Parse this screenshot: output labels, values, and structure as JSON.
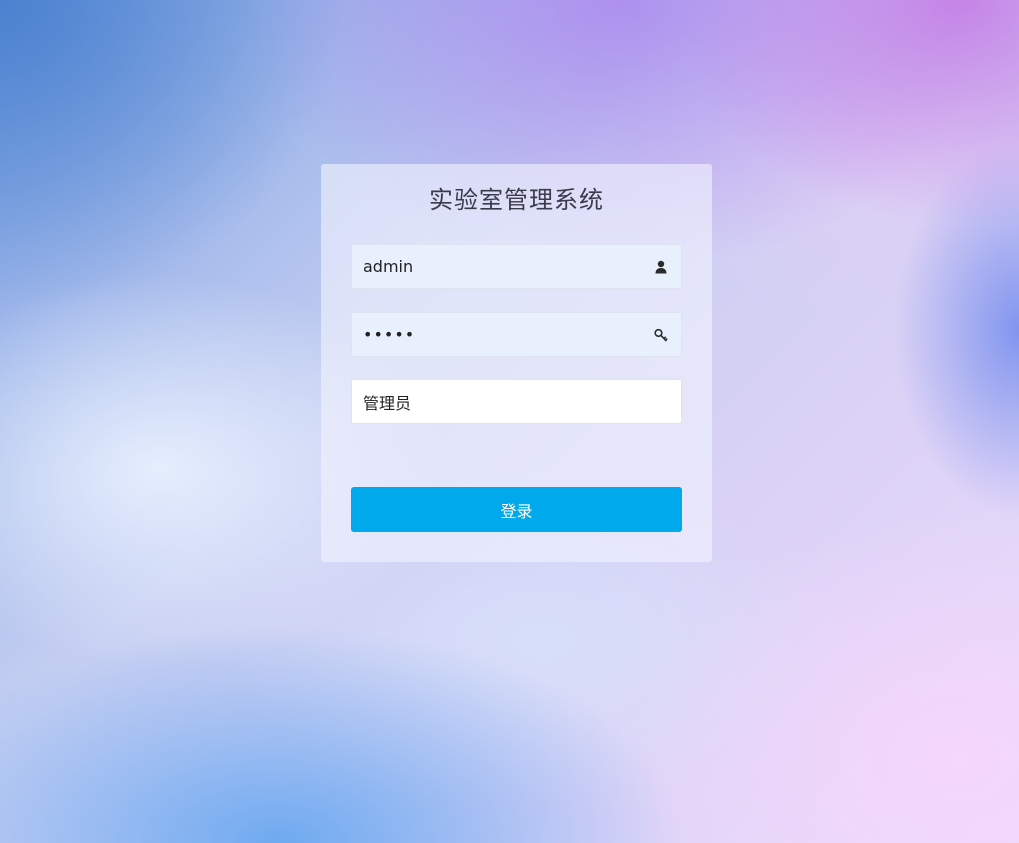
{
  "login": {
    "title": "实验室管理系统",
    "username": {
      "value": "admin",
      "icon": "user-icon"
    },
    "password": {
      "masked_value": "•••••",
      "icon": "key-icon"
    },
    "role": {
      "selected": "管理员"
    },
    "submit_label": "登录"
  },
  "colors": {
    "button": "#00a8ec",
    "autofill_field": "#e8f0fe",
    "title_text": "#3a3a4a"
  }
}
